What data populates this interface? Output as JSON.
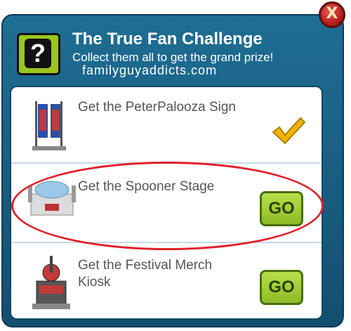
{
  "dialog": {
    "title": "The True Fan Challenge",
    "subtitle": "Collect them all to get the grand prize!",
    "watermark": "familyguyaddicts.com",
    "close_label": "X"
  },
  "items": [
    {
      "label": "Get the PeterPalooza Sign",
      "status": "complete",
      "icon": "checkmark-icon"
    },
    {
      "label": "Get the Spooner Stage",
      "status": "go",
      "button": "GO",
      "highlighted": true
    },
    {
      "label": "Get the Festival Merch Kiosk",
      "status": "go",
      "button": "GO"
    }
  ],
  "colors": {
    "dialog_bg": "#1a6389",
    "go_button": "#9ccb33",
    "close_button": "#c42828",
    "highlight": "#e0202a",
    "check": "#f2b400"
  }
}
